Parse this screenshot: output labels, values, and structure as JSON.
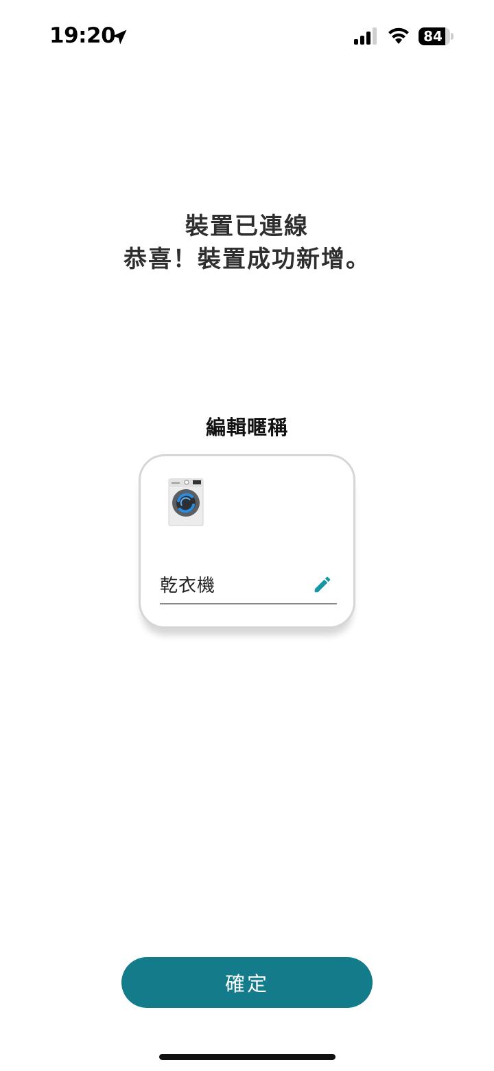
{
  "status_bar": {
    "time": "19:20",
    "battery_level": "84",
    "battery_percent": 84,
    "icons": [
      "location-arrow-icon",
      "cellular-signal-icon",
      "wifi-icon",
      "battery-icon"
    ]
  },
  "header": {
    "title": "裝置已連線",
    "subtitle": "恭喜！裝置成功新增。"
  },
  "nickname_section": {
    "label": "編輯暱稱"
  },
  "device_card": {
    "image_icon": "washer-dryer-icon",
    "nickname_value": "乾衣機",
    "edit_icon": "pencil-icon"
  },
  "actions": {
    "confirm_label": "確定"
  },
  "colors": {
    "primary": "#137b8a",
    "edit_icon": "#1797a6",
    "text_primary": "#2e2e2e",
    "card_border": "#d6d6d6"
  }
}
